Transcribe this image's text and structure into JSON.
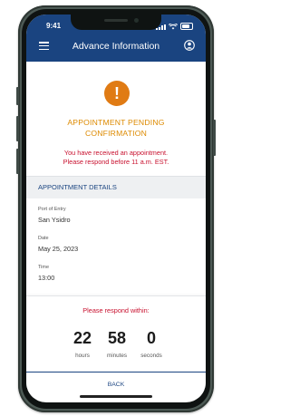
{
  "status_bar": {
    "time": "9:41"
  },
  "header": {
    "title": "Advance Information",
    "menu_icon": "hamburger-icon",
    "account_icon": "user-circle-icon"
  },
  "alert": {
    "icon": "exclamation-icon",
    "title_line1": "APPOINTMENT PENDING",
    "title_line2": "CONFIRMATION",
    "message_line1": "You have received an appointment.",
    "message_line2": "Please respond before 11 a.m. EST."
  },
  "details": {
    "section_title": "APPOINTMENT DETAILS",
    "fields": [
      {
        "label": "Port of Entry",
        "value": "San Ysidro"
      },
      {
        "label": "Date",
        "value": "May 25, 2023"
      },
      {
        "label": "Time",
        "value": "13:00"
      }
    ]
  },
  "countdown": {
    "title": "Please respond within:",
    "items": [
      {
        "value": "22",
        "unit": "hours"
      },
      {
        "value": "58",
        "unit": "minutes"
      },
      {
        "value": "0",
        "unit": "seconds"
      }
    ]
  },
  "footer": {
    "back_label": "BACK"
  },
  "colors": {
    "brand_blue": "#1a4480",
    "warning_orange": "#e07b14",
    "alert_red": "#c8102e"
  }
}
